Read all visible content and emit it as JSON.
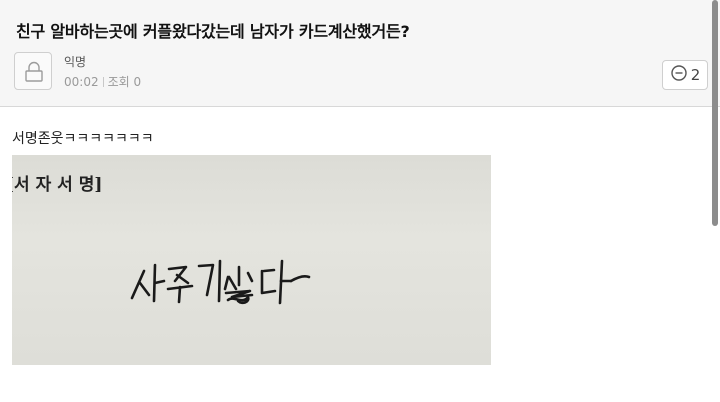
{
  "post": {
    "title": "친구 알바하는곳에 커플왔다갔는데 남자가 카드계산했거든?",
    "author": "익명",
    "time": "00:02",
    "views_label": "조회 0",
    "comment_count": "2",
    "body_text": "서명존웃ㅋㅋㅋㅋㅋㅋㅋ"
  },
  "photo": {
    "printed_label": "[서 자 서 명]",
    "handwritten_signature": "사주기싫다"
  },
  "icons": {
    "avatar": "lock-icon",
    "comment": "comment-bubble-icon"
  },
  "colors": {
    "header_bg": "#f6f6f6",
    "border": "#d8d8d8",
    "meta_text": "#9a9a9a"
  }
}
